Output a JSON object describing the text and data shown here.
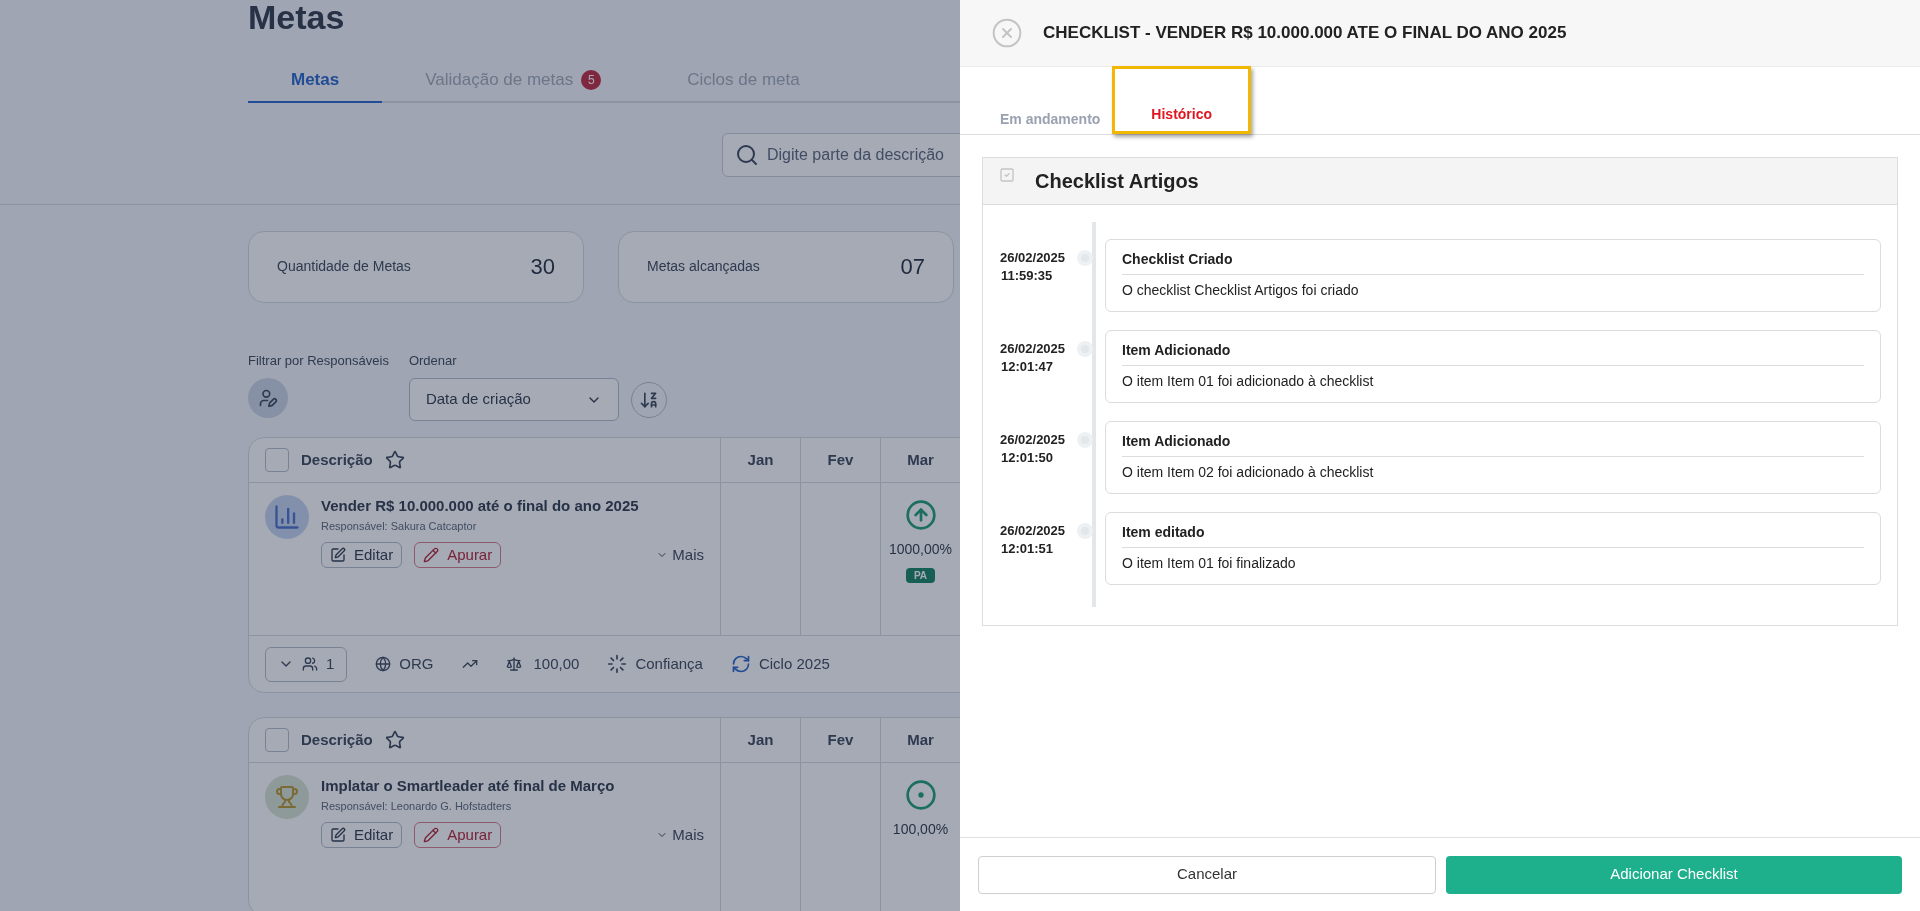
{
  "page": {
    "title": "Metas",
    "tabs": [
      {
        "label": "Metas",
        "selected": true
      },
      {
        "label": "Validação de metas",
        "selected": false,
        "badge": "5"
      },
      {
        "label": "Ciclos de meta",
        "selected": false
      }
    ],
    "search": {
      "placeholder": "Digite parte da descrição"
    },
    "stats": [
      {
        "label": "Quantidade de Metas",
        "value": "30"
      },
      {
        "label": "Metas alcançadas",
        "value": "07"
      }
    ],
    "filter_label": "Filtrar por Responsáveis",
    "sort_label": "Ordenar",
    "sort_value": "Data de criação",
    "goals": [
      {
        "header": "Descrição",
        "months": [
          "Jan",
          "Fev",
          "Mar"
        ],
        "title": "Vender R$ 10.000.000 até o final do ano 2025",
        "responsible": "Responsável: Sakura Catcaptor",
        "checked": false,
        "avatar": {
          "kind": "chart"
        },
        "edit": "Editar",
        "measure": "Apurar",
        "more": "Mais",
        "status": {
          "kind": "up"
        },
        "percent": "1000,00%",
        "badge": "PA",
        "footer": {
          "members": "1",
          "scope": "ORG",
          "weight": "100,00",
          "confidence": "Confiança",
          "cycle": "Ciclo 2025"
        }
      },
      {
        "header": "Descrição",
        "months": [
          "Jan",
          "Fev",
          "Mar"
        ],
        "title": "Implatar o Smartleader até final de Março",
        "responsible": "Responsável: Leonardo G. Hofstadters",
        "checked": false,
        "avatar": {
          "kind": "trophy"
        },
        "edit": "Editar",
        "measure": "Apurar",
        "more": "Mais",
        "status": {
          "kind": "target"
        },
        "percent": "100,00%"
      }
    ]
  },
  "panel": {
    "title": "CHECKLIST - VENDER R$ 10.000.000 ATE O FINAL DO ANO 2025",
    "tabs": [
      {
        "label": "Em andamento",
        "selected": false
      },
      {
        "label": "Histórico",
        "selected": true
      }
    ],
    "section": {
      "title": "Checklist Artigos",
      "events": [
        {
          "date": "26/02/2025",
          "time": "11:59:35",
          "title": "Checklist Criado",
          "text": "O checklist Checklist Artigos foi criado"
        },
        {
          "date": "26/02/2025",
          "time": "12:01:47",
          "title": "Item Adicionado",
          "text": "O item Item 01 foi adicionado à checklist"
        },
        {
          "date": "26/02/2025",
          "time": "12:01:50",
          "title": "Item Adicionado",
          "text": "O item Item 02 foi adicionado à checklist"
        },
        {
          "date": "26/02/2025",
          "time": "12:01:51",
          "title": "Item editado",
          "text": "O item Item 01 foi finalizado"
        }
      ]
    },
    "buttons": {
      "cancel": "Cancelar",
      "submit": "Adicionar Checklist"
    }
  }
}
